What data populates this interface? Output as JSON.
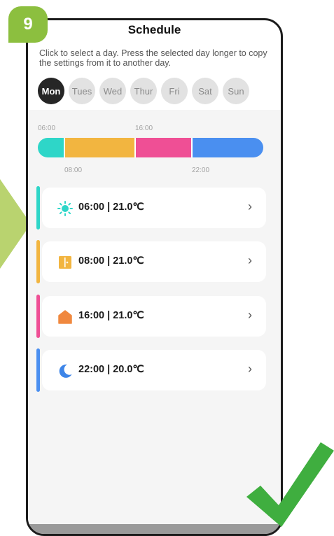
{
  "step_badge": "9",
  "screen": {
    "title": "Schedule",
    "hint": "Click to select a day. Press the selected day longer to copy the settings from it to another day.",
    "days": [
      {
        "label": "Mon",
        "active": true
      },
      {
        "label": "Tues",
        "active": false
      },
      {
        "label": "Wed",
        "active": false
      },
      {
        "label": "Thur",
        "active": false
      },
      {
        "label": "Fri",
        "active": false
      },
      {
        "label": "Sat",
        "active": false
      },
      {
        "label": "Sun",
        "active": false
      }
    ],
    "timeline": {
      "top_labels": [
        "06:00",
        "16:00"
      ],
      "bottom_labels": [
        "08:00",
        "22:00"
      ],
      "segments": [
        {
          "from": "06:00",
          "to": "08:00",
          "color": "#2ed6c8"
        },
        {
          "from": "08:00",
          "to": "16:00",
          "color": "#f2b540"
        },
        {
          "from": "16:00",
          "to": "22:00",
          "color": "#ef4f95"
        },
        {
          "from": "22:00",
          "to": "06:00",
          "color": "#4a8ff0"
        }
      ]
    },
    "entries": [
      {
        "text": "06:00 | 21.0℃",
        "icon": "sun-icon",
        "color": "#2ed6c8"
      },
      {
        "text": "08:00 | 21.0℃",
        "icon": "door-icon",
        "color": "#f2b540"
      },
      {
        "text": "16:00 | 21.0℃",
        "icon": "home-icon",
        "color": "#ef4f95"
      },
      {
        "text": "22:00 | 20.0℃",
        "icon": "moon-icon",
        "color": "#4a8ff0"
      }
    ],
    "chevron": "›"
  },
  "colors": {
    "badge": "#8cbf3f",
    "arrow": "#b9d36f",
    "check": "#3fae3f",
    "icon_orange": "#f0883f",
    "icon_blue": "#3d85e8"
  }
}
